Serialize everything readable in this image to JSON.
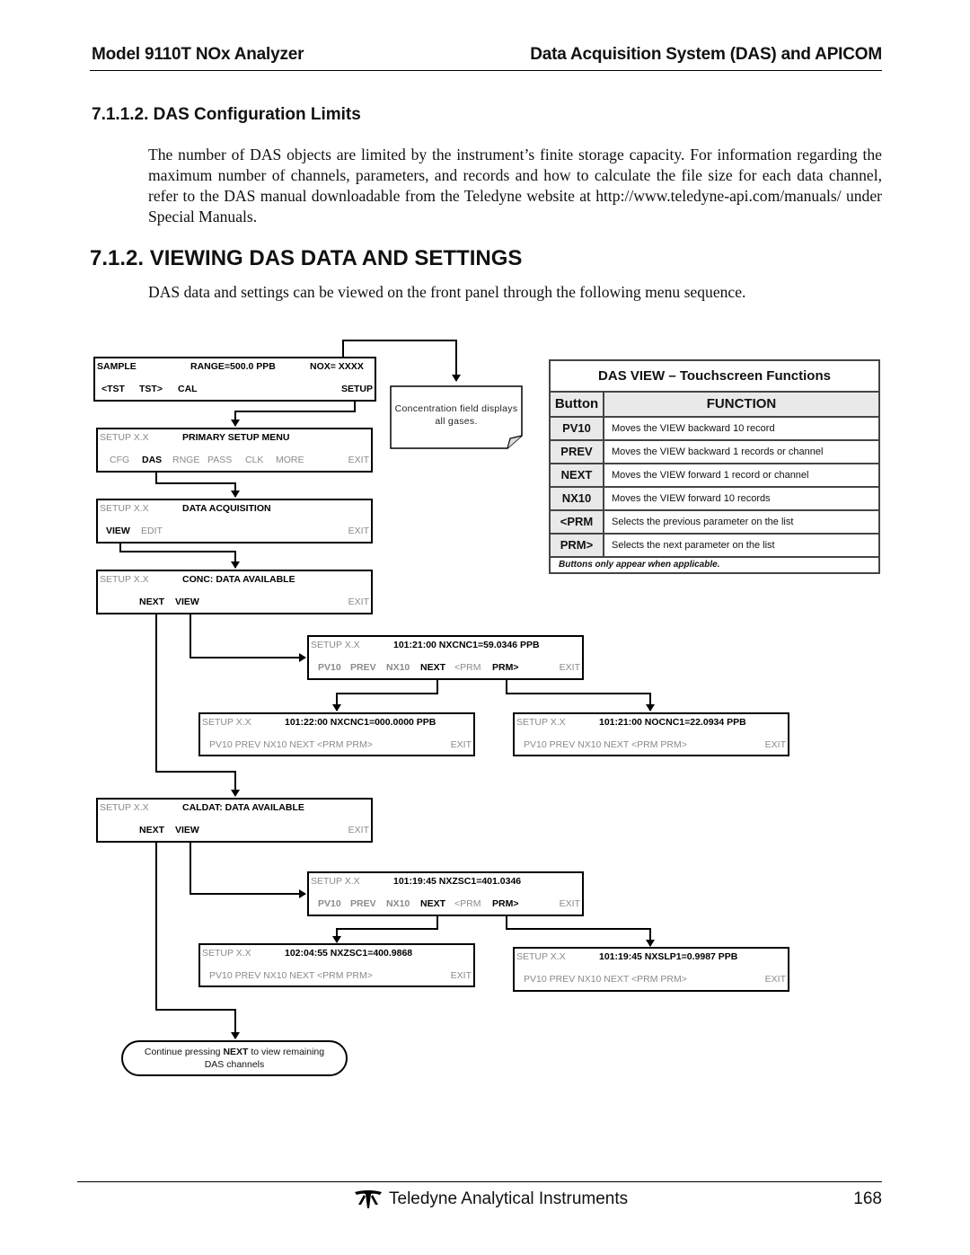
{
  "header": {
    "left": "Model 9110T NOx Analyzer",
    "right": "Data Acquisition System (DAS) and APICOM"
  },
  "section_7_1_1_2": {
    "heading": "7.1.1.2.  DAS Configuration Limits",
    "body": "The number of DAS objects are limited by the instrument’s finite storage capacity. For information regarding the maximum number of channels, parameters, and records and how to calculate the file size for each data channel, refer to the DAS manual downloadable from the Teledyne website at http://www.teledyne-api.com/manuals/ under Special Manuals."
  },
  "section_7_1_2": {
    "heading": "7.1.2. VIEWING DAS DATA AND SETTINGS",
    "body": "DAS data and settings can be viewed on the front panel through the following menu sequence."
  },
  "diagram": {
    "panels": {
      "sample": {
        "r1": [
          "SAMPLE",
          "RANGE=500.0 PPB",
          "NOX= XXXX"
        ],
        "r2": [
          "<TST",
          "TST>",
          "CAL",
          "SETUP"
        ]
      },
      "primary_setup": {
        "r1": [
          "SETUP X.X",
          "PRIMARY SETUP MENU"
        ],
        "r2": [
          "CFG",
          "DAS",
          "RNGE",
          "PASS",
          "CLK",
          "MORE",
          "EXIT"
        ]
      },
      "data_acq": {
        "r1": [
          "SETUP X.X",
          "DATA ACQUISITION"
        ],
        "r2": [
          "VIEW",
          "EDIT",
          "EXIT"
        ]
      },
      "conc": {
        "r1": [
          "SETUP X.X",
          "CONC: DATA AVAILABLE"
        ],
        "r2": [
          "NEXT",
          "VIEW",
          "EXIT"
        ]
      },
      "nxcnc1_a": {
        "r1": [
          "SETUP X.X",
          "101:21:00  NXCNC1=59.0346 PPB"
        ],
        "r2": [
          "PV10",
          "PREV",
          "NX10",
          "NEXT",
          "<PRM",
          "PRM>",
          "EXIT"
        ]
      },
      "nxcnc1_b": {
        "r1": [
          "SETUP X.X",
          "101:22:00  NXCNC1=000.0000 PPB"
        ],
        "r2": [
          "PV10  PREV  NX10  NEXT  <PRM  PRM>",
          "EXIT"
        ]
      },
      "nocnc1": {
        "r1": [
          "SETUP X.X",
          "101:21:00  NOCNC1=22.0934 PPB"
        ],
        "r2": [
          "PV10  PREV  NX10  NEXT  <PRM  PRM>",
          "EXIT"
        ]
      },
      "caldat": {
        "r1": [
          "SETUP X.X",
          "CALDAT: DATA AVAILABLE"
        ],
        "r2": [
          "NEXT",
          "VIEW",
          "EXIT"
        ]
      },
      "nxzsc1_a": {
        "r1": [
          "SETUP X.X",
          "101:19:45  NXZSC1=401.0346"
        ],
        "r2": [
          "PV10",
          "PREV",
          "NX10",
          "NEXT",
          "<PRM",
          "PRM>",
          "EXIT"
        ]
      },
      "nxzsc1_b": {
        "r1": [
          "SETUP X.X",
          "102:04:55  NXZSC1=400.9868"
        ],
        "r2": [
          "PV10  PREV  NX10  NEXT  <PRM  PRM>",
          "EXIT"
        ]
      },
      "nxslp1": {
        "r1": [
          "SETUP X.X",
          "101:19:45  NXSLP1=0.9987 PPB"
        ],
        "r2": [
          "PV10  PREV  NX10  NEXT  <PRM  PRM>",
          "EXIT"
        ]
      }
    },
    "note": "Concentration field displays all gases.",
    "oval": {
      "pre": "Continue pressing ",
      "bold": "NEXT",
      "post": " to view remaining",
      "line2": "DAS channels"
    }
  },
  "table": {
    "title": "DAS VIEW – Touchscreen Functions",
    "headers": [
      "Button",
      "FUNCTION"
    ],
    "rows": [
      {
        "button": "PV10",
        "function": "Moves the VIEW backward 10 record"
      },
      {
        "button": "PREV",
        "function": "Moves the VIEW backward 1 records or channel"
      },
      {
        "button": "NEXT",
        "function": "Moves the VIEW forward 1 record or channel"
      },
      {
        "button": "NX10",
        "function": "Moves the VIEW forward 10 records"
      },
      {
        "button": "<PRM",
        "function": "Selects the previous parameter on the list"
      },
      {
        "button": "PRM>",
        "function": "Selects the next parameter on the list"
      }
    ],
    "footnote": "Buttons only appear when applicable."
  },
  "footer": {
    "brand": "Teledyne Analytical Instruments",
    "logo_icon": "teledyne-logo-icon",
    "page_number": "168"
  }
}
